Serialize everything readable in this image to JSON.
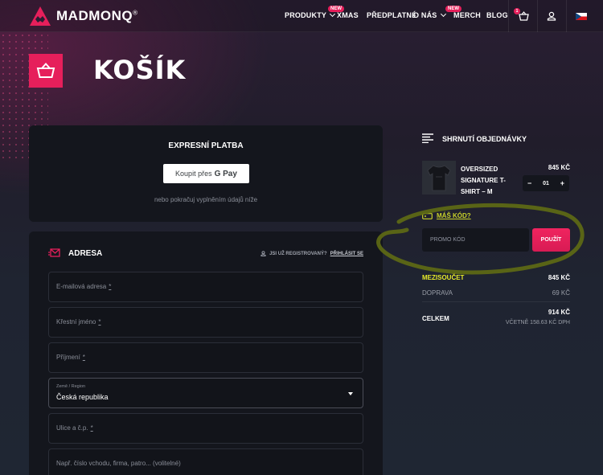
{
  "brand": {
    "name": "MADMONQ",
    "reg": "®",
    "accent": "#e61f5b",
    "highlight": "#e6eb2a"
  },
  "nav": {
    "items": [
      {
        "label": "PRODUKTY",
        "badge": "NEW"
      },
      {
        "label": "XMAS"
      },
      {
        "label": "PŘEDPLATNÉ"
      },
      {
        "label": "O NÁS",
        "badge": "NEW"
      },
      {
        "label": "MERCH"
      },
      {
        "label": "BLOG"
      }
    ],
    "cart_count": "1",
    "icons": [
      "cart-icon",
      "user-icon",
      "czech-flag-icon"
    ]
  },
  "page": {
    "title": "KOŠÍK"
  },
  "express": {
    "title": "EXPRESNÍ PLATBA",
    "gpay_label": "Koupit přes",
    "gpay_brand": "G Pay",
    "subtitle": "nebo pokračuj vyplněním údajů níže"
  },
  "address": {
    "title": "ADRESA",
    "login_note": "JSI UŽ REGISTROVANÝ?",
    "login_link": "PŘIHLÁSIT SE",
    "fields": [
      {
        "placeholder": "E-mailová adresa",
        "required": "*"
      },
      {
        "placeholder": "Křestní jméno",
        "required": "*"
      },
      {
        "placeholder": "Příjmení",
        "required": "*"
      },
      {
        "label": "Země / Region",
        "value": "Česká republika"
      },
      {
        "placeholder": "Ulice a č.p.",
        "required": "*"
      },
      {
        "placeholder": "Např. číslo vchodu, firma, patro... (volitelné)"
      }
    ]
  },
  "summary": {
    "title": "SHRNUTÍ OBJEDNÁVKY",
    "product": {
      "name": "OVERSIZED SIGNATURE T-SHIRT – M",
      "price": "845 KČ",
      "qty": "01",
      "minus": "−",
      "plus": "+"
    },
    "promo_question": "MÁŠ KÓD?",
    "promo_placeholder": "PROMO KÓD",
    "promo_button": "POUŽÍT",
    "subtotal_label": "MEZISOUČET",
    "subtotal_value": "845 KČ",
    "shipping_label": "DOPRAVA",
    "shipping_value": "69 KČ",
    "total_label": "CELKEM",
    "total_value": "914 KČ",
    "vat_note": "VČETNĚ 158.63 KČ DPH"
  }
}
